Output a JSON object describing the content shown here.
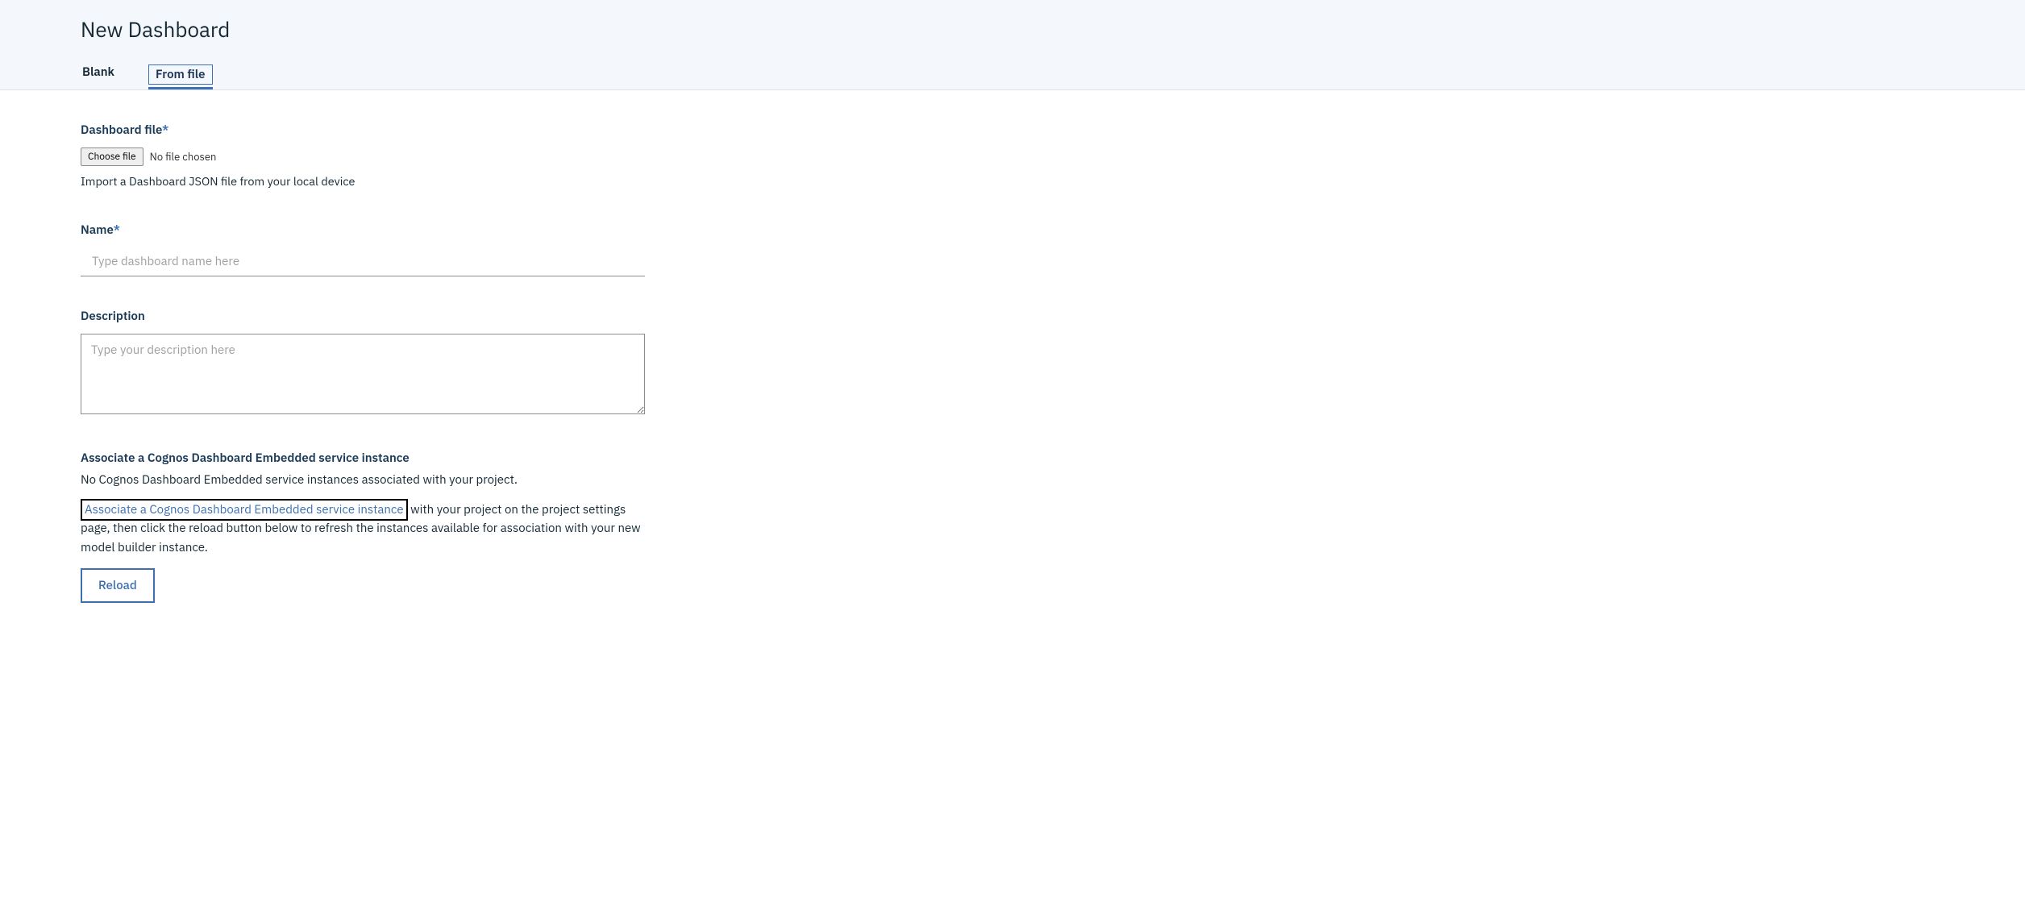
{
  "header": {
    "title": "New Dashboard",
    "tabs": [
      {
        "label": "Blank",
        "active": false
      },
      {
        "label": "From file",
        "active": true
      }
    ]
  },
  "form": {
    "dashboard_file": {
      "label": "Dashboard file",
      "required_marker": "*",
      "choose_button": "Choose file",
      "status": "No file chosen",
      "help": "Import a Dashboard JSON file from your local device"
    },
    "name": {
      "label": "Name",
      "required_marker": "*",
      "placeholder": "Type dashboard name here",
      "value": ""
    },
    "description": {
      "label": "Description",
      "placeholder": "Type your description here",
      "value": ""
    },
    "associate": {
      "heading": "Associate a Cognos Dashboard Embedded service instance",
      "status_line": "No Cognos Dashboard Embedded service instances associated with your project.",
      "link_text": "Associate a Cognos Dashboard Embedded service instance",
      "trailing_text": " with your project on the project settings page, then click the reload button below to refresh the instances available for association with your new model builder instance.",
      "reload_button": "Reload"
    }
  }
}
